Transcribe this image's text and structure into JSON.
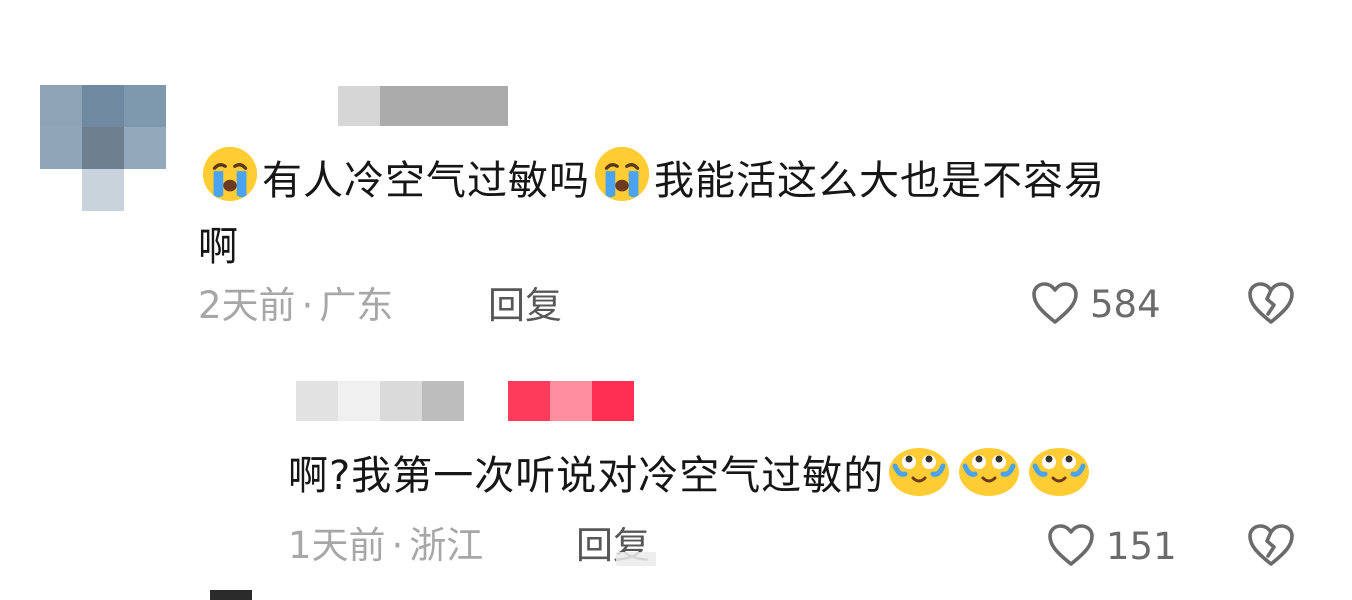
{
  "comments": [
    {
      "text_part1": "有人冷空气过敏吗",
      "text_part2": "我能活这么大也是不容易",
      "text_part3": "啊",
      "time": "2天前",
      "separator": "·",
      "location": "广东",
      "reply_label": "回复",
      "likes": "584",
      "emoji_inline": "loudly-crying-face"
    },
    {
      "text": "啊?我第一次听说对冷空气过敏的",
      "time": "1天前",
      "separator": "·",
      "location": "浙江",
      "reply_label": "回复",
      "likes": "151",
      "emoji_trailing": "face-with-tears-of-joy-looking-up"
    }
  ],
  "icons": {
    "like": "heart-outline-icon",
    "dislike": "broken-heart-icon"
  },
  "colors": {
    "text": "#161616",
    "meta": "#a7a7a7",
    "reply": "#575757",
    "icon": "#6b6b6b",
    "redacted_pink": "#ff3b5c"
  }
}
